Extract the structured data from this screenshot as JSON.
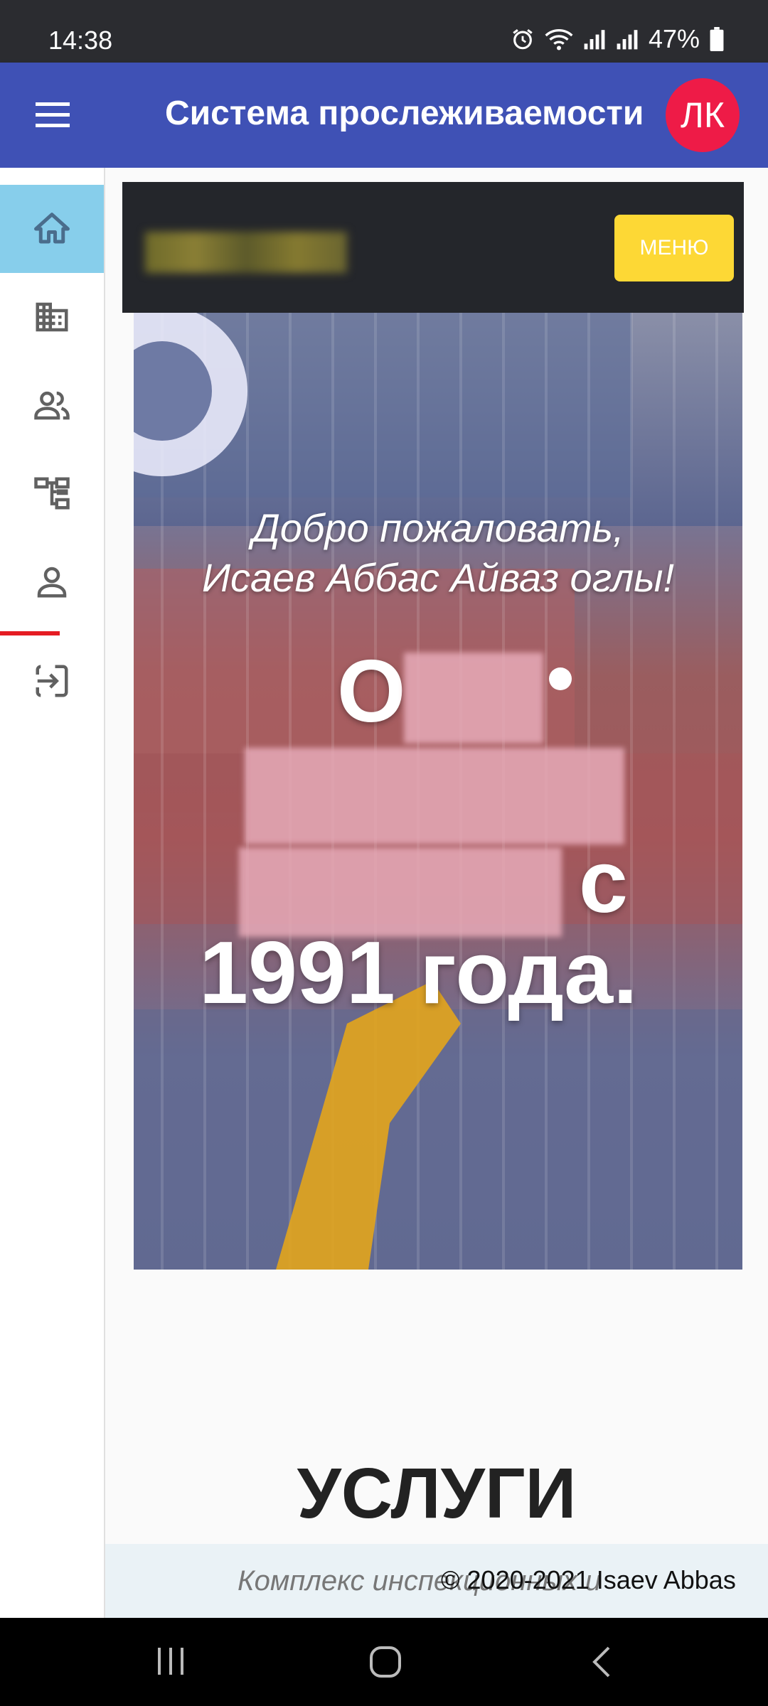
{
  "status_bar": {
    "time": "14:38",
    "battery": "47%"
  },
  "app_bar": {
    "title": "Система прослеживаемости",
    "avatar_text": "ЛК"
  },
  "side_rail": {
    "items": [
      {
        "icon": "home-icon",
        "active": true
      },
      {
        "icon": "building-icon",
        "active": false
      },
      {
        "icon": "people-icon",
        "active": false
      },
      {
        "icon": "hierarchy-icon",
        "active": false
      },
      {
        "icon": "person-icon",
        "active": false
      },
      {
        "icon": "login-icon",
        "active": false
      }
    ]
  },
  "header": {
    "menu_button": "МЕНЮ"
  },
  "hero": {
    "welcome_line1": "Добро пожаловать,",
    "welcome_line2": "Исаев Аббас Айваз оглы!",
    "big_o": "О",
    "big_s": "с",
    "big_year": "1991 года."
  },
  "services": {
    "title": "УСЛУГИ",
    "description": "Комплекс инспекционных и"
  },
  "footer": {
    "copyright": "© 2020-2021 Isaev Abbas"
  },
  "colors": {
    "app_bar": "#3f51b5",
    "avatar": "#ee1b47",
    "menu_button": "#fdd835",
    "rail_active": "#87ceeb"
  }
}
